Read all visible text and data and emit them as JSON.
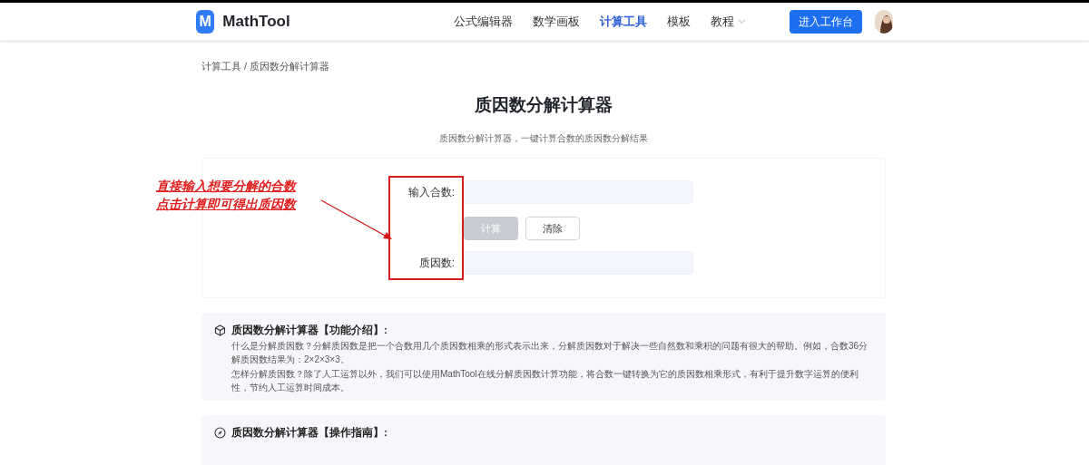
{
  "nav": {
    "logo_letter": "M",
    "brand": "MathTool",
    "links": [
      {
        "label": "公式编辑器",
        "selected": false
      },
      {
        "label": "数学画板",
        "selected": false
      },
      {
        "label": "计算工具",
        "selected": true
      },
      {
        "label": "模板",
        "selected": false
      },
      {
        "label": "教程",
        "selected": false,
        "dropdown": true
      }
    ],
    "cta": "进入工作台"
  },
  "breadcrumb": "计算工具 / 质因数分解计算器",
  "title": "质因数分解计算器",
  "subtitle": "质因数分解计算器，一键计算合数的质因数分解结果",
  "form": {
    "input_label": "输入合数:",
    "buttons": [
      {
        "label": "计算",
        "disabled": true
      },
      {
        "label": "清除",
        "disabled": false
      }
    ],
    "output_label": "质因数:"
  },
  "annotation": {
    "lines": [
      "直接输入想要分解的合数",
      "点击计算即可得出质因数"
    ]
  },
  "sections": [
    {
      "heading": "质因数分解计算器【功能介绍】:",
      "paragraphs": [
        "什么是分解质因数？分解质因数是把一个合数用几个质因数相乘的形式表示出来，分解质因数对于解决一些自然数和乘积的问题有很大的帮助。例如，合数36分解质因数结果为：2×2×3×3。",
        "怎样分解质因数？除了人工运算以外，我们可以使用MathTool在线分解质因数计算功能，将合数一键转换为它的质因数相乘形式，有利于提升数字运算的便利性，节约人工运算时间成本。"
      ]
    },
    {
      "heading": "质因数分解计算器【操作指南】:"
    }
  ]
}
